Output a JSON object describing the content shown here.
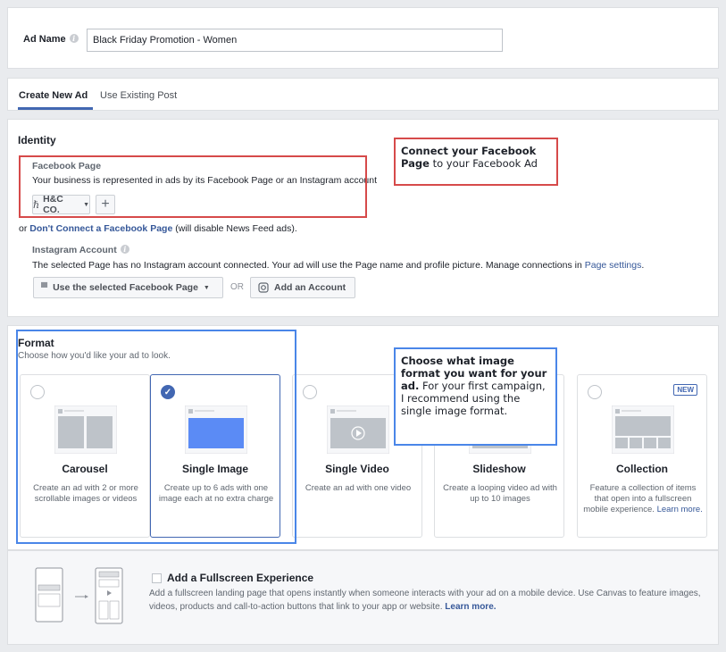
{
  "ad_name": {
    "label": "Ad Name",
    "value": "Black Friday Promotion - Women"
  },
  "tabs": [
    {
      "label": "Create New Ad",
      "active": true
    },
    {
      "label": "Use Existing Post",
      "active": false
    }
  ],
  "identity": {
    "title": "Identity",
    "facebook_page": {
      "label": "Facebook Page",
      "desc": "Your business is represented in ads by its Facebook Page or an Instagram account",
      "selected_page": "H&C CO.",
      "plus_label": "+"
    },
    "dont_connect": {
      "prefix": "or ",
      "link": "Don't Connect a Facebook Page",
      "suffix": " (will disable News Feed ads)."
    },
    "instagram": {
      "label": "Instagram Account",
      "desc_prefix": "The selected Page has no Instagram account connected. Your ad will use the Page name and profile picture. Manage connections in ",
      "desc_link": "Page settings",
      "desc_suffix": ".",
      "use_page_button": "Use the selected Facebook Page",
      "or_label": "OR",
      "add_account_button": "Add an Account"
    }
  },
  "callout_identity": {
    "bold": "Connect your Facebook Page",
    "rest": " to your Facebook Ad"
  },
  "format": {
    "title": "Format",
    "subtitle": "Choose how you'd like your ad to look.",
    "cards": [
      {
        "title": "Carousel",
        "desc": "Create an ad with 2 or more scrollable images or videos",
        "selected": false
      },
      {
        "title": "Single Image",
        "desc": "Create up to 6 ads with one image each at no extra charge",
        "selected": true
      },
      {
        "title": "Single Video",
        "desc": "Create an ad with one video",
        "selected": false
      },
      {
        "title": "Slideshow",
        "desc": "Create a looping video ad with up to 10 images",
        "selected": false
      },
      {
        "title": "Collection",
        "desc": "Feature a collection of items that open into a fullscreen mobile experience.",
        "link": "Learn more.",
        "badge": "NEW",
        "selected": false
      }
    ]
  },
  "callout_format": {
    "bold": "Choose what image format you want for your ad.",
    "rest": " For your first campaign, I recommend using the single image format."
  },
  "fullscreen": {
    "title": "Add a Fullscreen Experience",
    "desc": "Add a fullscreen landing page that opens instantly when someone interacts with your ad on a mobile device. Use Canvas to feature images, videos, products and call-to-action buttons that link to your app or website.",
    "link": "Learn more."
  },
  "colors": {
    "accent": "#4267b2",
    "link": "#365899",
    "callout_red": "#d64a4a",
    "callout_blue": "#4a86e8"
  }
}
